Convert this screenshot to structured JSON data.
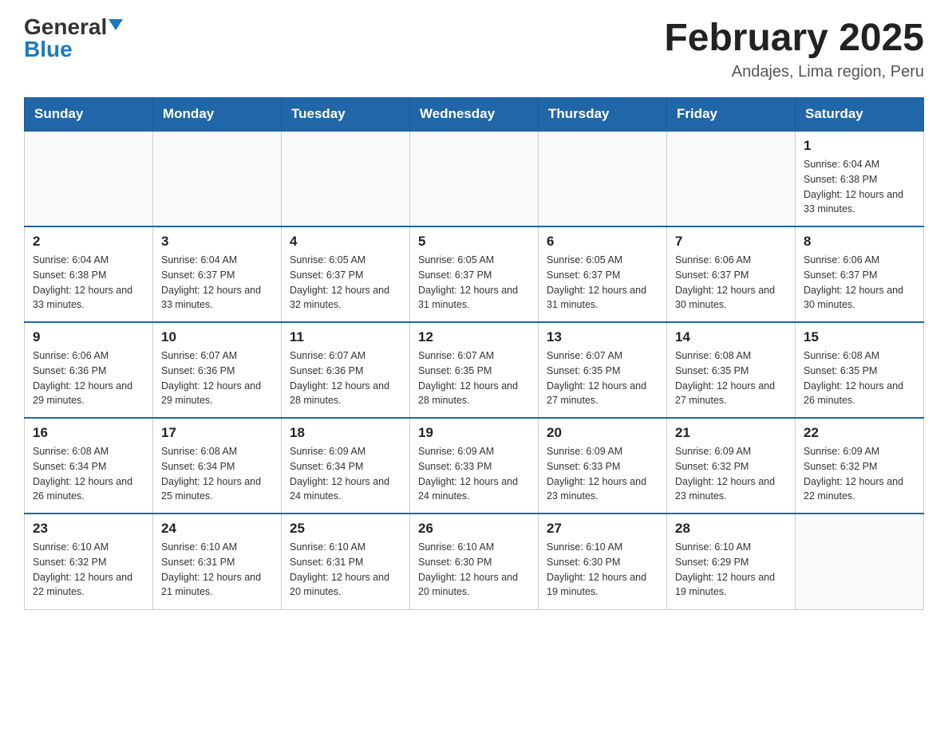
{
  "header": {
    "logo": {
      "general": "General",
      "blue": "Blue",
      "arrow": "▼"
    },
    "title": "February 2025",
    "location": "Andajes, Lima region, Peru"
  },
  "days_of_week": [
    "Sunday",
    "Monday",
    "Tuesday",
    "Wednesday",
    "Thursday",
    "Friday",
    "Saturday"
  ],
  "weeks": [
    [
      {
        "day": "",
        "info": ""
      },
      {
        "day": "",
        "info": ""
      },
      {
        "day": "",
        "info": ""
      },
      {
        "day": "",
        "info": ""
      },
      {
        "day": "",
        "info": ""
      },
      {
        "day": "",
        "info": ""
      },
      {
        "day": "1",
        "info": "Sunrise: 6:04 AM\nSunset: 6:38 PM\nDaylight: 12 hours and 33 minutes."
      }
    ],
    [
      {
        "day": "2",
        "info": "Sunrise: 6:04 AM\nSunset: 6:38 PM\nDaylight: 12 hours and 33 minutes."
      },
      {
        "day": "3",
        "info": "Sunrise: 6:04 AM\nSunset: 6:37 PM\nDaylight: 12 hours and 33 minutes."
      },
      {
        "day": "4",
        "info": "Sunrise: 6:05 AM\nSunset: 6:37 PM\nDaylight: 12 hours and 32 minutes."
      },
      {
        "day": "5",
        "info": "Sunrise: 6:05 AM\nSunset: 6:37 PM\nDaylight: 12 hours and 31 minutes."
      },
      {
        "day": "6",
        "info": "Sunrise: 6:05 AM\nSunset: 6:37 PM\nDaylight: 12 hours and 31 minutes."
      },
      {
        "day": "7",
        "info": "Sunrise: 6:06 AM\nSunset: 6:37 PM\nDaylight: 12 hours and 30 minutes."
      },
      {
        "day": "8",
        "info": "Sunrise: 6:06 AM\nSunset: 6:37 PM\nDaylight: 12 hours and 30 minutes."
      }
    ],
    [
      {
        "day": "9",
        "info": "Sunrise: 6:06 AM\nSunset: 6:36 PM\nDaylight: 12 hours and 29 minutes."
      },
      {
        "day": "10",
        "info": "Sunrise: 6:07 AM\nSunset: 6:36 PM\nDaylight: 12 hours and 29 minutes."
      },
      {
        "day": "11",
        "info": "Sunrise: 6:07 AM\nSunset: 6:36 PM\nDaylight: 12 hours and 28 minutes."
      },
      {
        "day": "12",
        "info": "Sunrise: 6:07 AM\nSunset: 6:35 PM\nDaylight: 12 hours and 28 minutes."
      },
      {
        "day": "13",
        "info": "Sunrise: 6:07 AM\nSunset: 6:35 PM\nDaylight: 12 hours and 27 minutes."
      },
      {
        "day": "14",
        "info": "Sunrise: 6:08 AM\nSunset: 6:35 PM\nDaylight: 12 hours and 27 minutes."
      },
      {
        "day": "15",
        "info": "Sunrise: 6:08 AM\nSunset: 6:35 PM\nDaylight: 12 hours and 26 minutes."
      }
    ],
    [
      {
        "day": "16",
        "info": "Sunrise: 6:08 AM\nSunset: 6:34 PM\nDaylight: 12 hours and 26 minutes."
      },
      {
        "day": "17",
        "info": "Sunrise: 6:08 AM\nSunset: 6:34 PM\nDaylight: 12 hours and 25 minutes."
      },
      {
        "day": "18",
        "info": "Sunrise: 6:09 AM\nSunset: 6:34 PM\nDaylight: 12 hours and 24 minutes."
      },
      {
        "day": "19",
        "info": "Sunrise: 6:09 AM\nSunset: 6:33 PM\nDaylight: 12 hours and 24 minutes."
      },
      {
        "day": "20",
        "info": "Sunrise: 6:09 AM\nSunset: 6:33 PM\nDaylight: 12 hours and 23 minutes."
      },
      {
        "day": "21",
        "info": "Sunrise: 6:09 AM\nSunset: 6:32 PM\nDaylight: 12 hours and 23 minutes."
      },
      {
        "day": "22",
        "info": "Sunrise: 6:09 AM\nSunset: 6:32 PM\nDaylight: 12 hours and 22 minutes."
      }
    ],
    [
      {
        "day": "23",
        "info": "Sunrise: 6:10 AM\nSunset: 6:32 PM\nDaylight: 12 hours and 22 minutes."
      },
      {
        "day": "24",
        "info": "Sunrise: 6:10 AM\nSunset: 6:31 PM\nDaylight: 12 hours and 21 minutes."
      },
      {
        "day": "25",
        "info": "Sunrise: 6:10 AM\nSunset: 6:31 PM\nDaylight: 12 hours and 20 minutes."
      },
      {
        "day": "26",
        "info": "Sunrise: 6:10 AM\nSunset: 6:30 PM\nDaylight: 12 hours and 20 minutes."
      },
      {
        "day": "27",
        "info": "Sunrise: 6:10 AM\nSunset: 6:30 PM\nDaylight: 12 hours and 19 minutes."
      },
      {
        "day": "28",
        "info": "Sunrise: 6:10 AM\nSunset: 6:29 PM\nDaylight: 12 hours and 19 minutes."
      },
      {
        "day": "",
        "info": ""
      }
    ]
  ]
}
